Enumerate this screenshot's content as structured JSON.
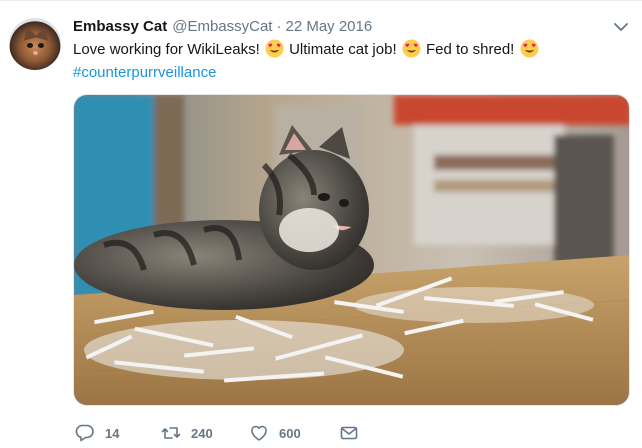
{
  "tweet": {
    "author_name": "Embassy Cat",
    "handle": "@EmbassyCat",
    "separator": "·",
    "date": "22 May 2016",
    "text_segments": [
      "Love working for WikiLeaks! ",
      " Ultimate cat job! ",
      " Fed to shred! "
    ],
    "emoji": "heart-eyes-emoji",
    "hashtag": "#counterpurrveillance",
    "photo": "kitten-with-shredded-paper-photo"
  },
  "actions": {
    "reply_count": "14",
    "retweet_count": "240",
    "like_count": "600"
  },
  "colors": {
    "link": "#1b95e0",
    "muted": "#657786",
    "text": "#14171a",
    "border": "#e6ecf0"
  }
}
